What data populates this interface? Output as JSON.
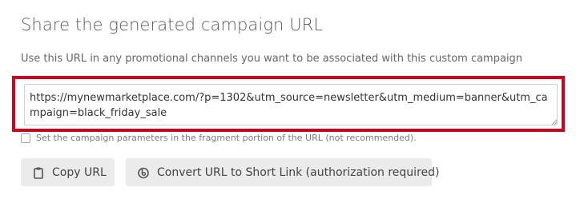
{
  "section": {
    "title": "Share the generated campaign URL",
    "description": "Use this URL in any promotional channels you want to be associated with this custom campaign"
  },
  "url_field": {
    "value": "https://mynewmarketplace.com/?p=1302&utm_source=newsletter&utm_medium=banner&utm_campaign=black_friday_sale"
  },
  "fragment_option": {
    "label": "Set the campaign parameters in the fragment portion of the URL (not recommended).",
    "checked": false
  },
  "buttons": {
    "copy_label": "Copy URL",
    "short_link_label": "Convert URL to Short Link (authorization required)"
  },
  "icons": {
    "copy": "clipboard-icon",
    "short_link": "bitly-icon"
  },
  "colors": {
    "highlight": "#d0021b",
    "button_bg": "#ebebeb"
  }
}
